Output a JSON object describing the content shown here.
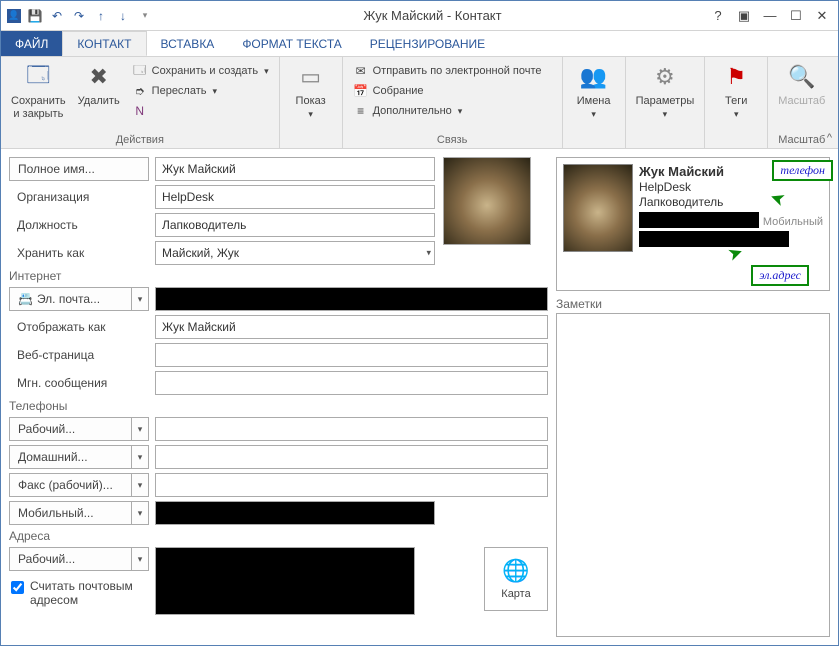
{
  "window": {
    "title": "Жук Майский - Контакт",
    "qat_icons": [
      "contact-icon",
      "save-icon",
      "undo-icon",
      "redo-icon",
      "up-icon",
      "down-icon",
      "dropdown-icon"
    ]
  },
  "tabs": {
    "file": "ФАЙЛ",
    "contact": "КОНТАКТ",
    "insert": "ВСТАВКА",
    "format": "ФОРМАТ ТЕКСТА",
    "review": "РЕЦЕНЗИРОВАНИЕ"
  },
  "ribbon": {
    "actions": {
      "label": "Действия",
      "save_close": "Сохранить\nи закрыть",
      "delete": "Удалить",
      "save_new": "Сохранить и создать",
      "forward": "Переслать"
    },
    "show": {
      "label": "Показ"
    },
    "link": {
      "label": "Связь",
      "send_email": "Отправить по электронной почте",
      "meeting": "Собрание",
      "more": "Дополнительно"
    },
    "names": {
      "label": "Имена"
    },
    "params": {
      "label": "Параметры"
    },
    "tags": {
      "label": "Теги"
    },
    "zoom": {
      "label": "Масштаб",
      "btn": "Масштаб"
    }
  },
  "form": {
    "full_name_btn": "Полное имя...",
    "full_name_val": "Жук Майский",
    "org_label": "Организация",
    "org_val": "HelpDesk",
    "title_label": "Должность",
    "title_val": "Лапководитель",
    "file_as_label": "Хранить как",
    "file_as_val": "Майский, Жук",
    "internet_header": "Интернет",
    "email_btn": "Эл. почта...",
    "display_as_label": "Отображать как",
    "display_as_val": "Жук Майский",
    "web_label": "Веб-страница",
    "im_label": "Мгн. сообщения",
    "phones_header": "Телефоны",
    "phone_work": "Рабочий...",
    "phone_home": "Домашний...",
    "phone_fax": "Факс (рабочий)...",
    "phone_mobile": "Мобильный...",
    "addr_header": "Адреса",
    "addr_work": "Рабочий...",
    "mailing_check": "Считать почтовым адресом",
    "map_btn": "Карта"
  },
  "card": {
    "name": "Жук Майский",
    "org": "HelpDesk",
    "title": "Лапководитель",
    "mobile_lbl": "Мобильный"
  },
  "annotations": {
    "phone": "телефон",
    "email": "эл.адрес"
  },
  "notes_label": "Заметки"
}
